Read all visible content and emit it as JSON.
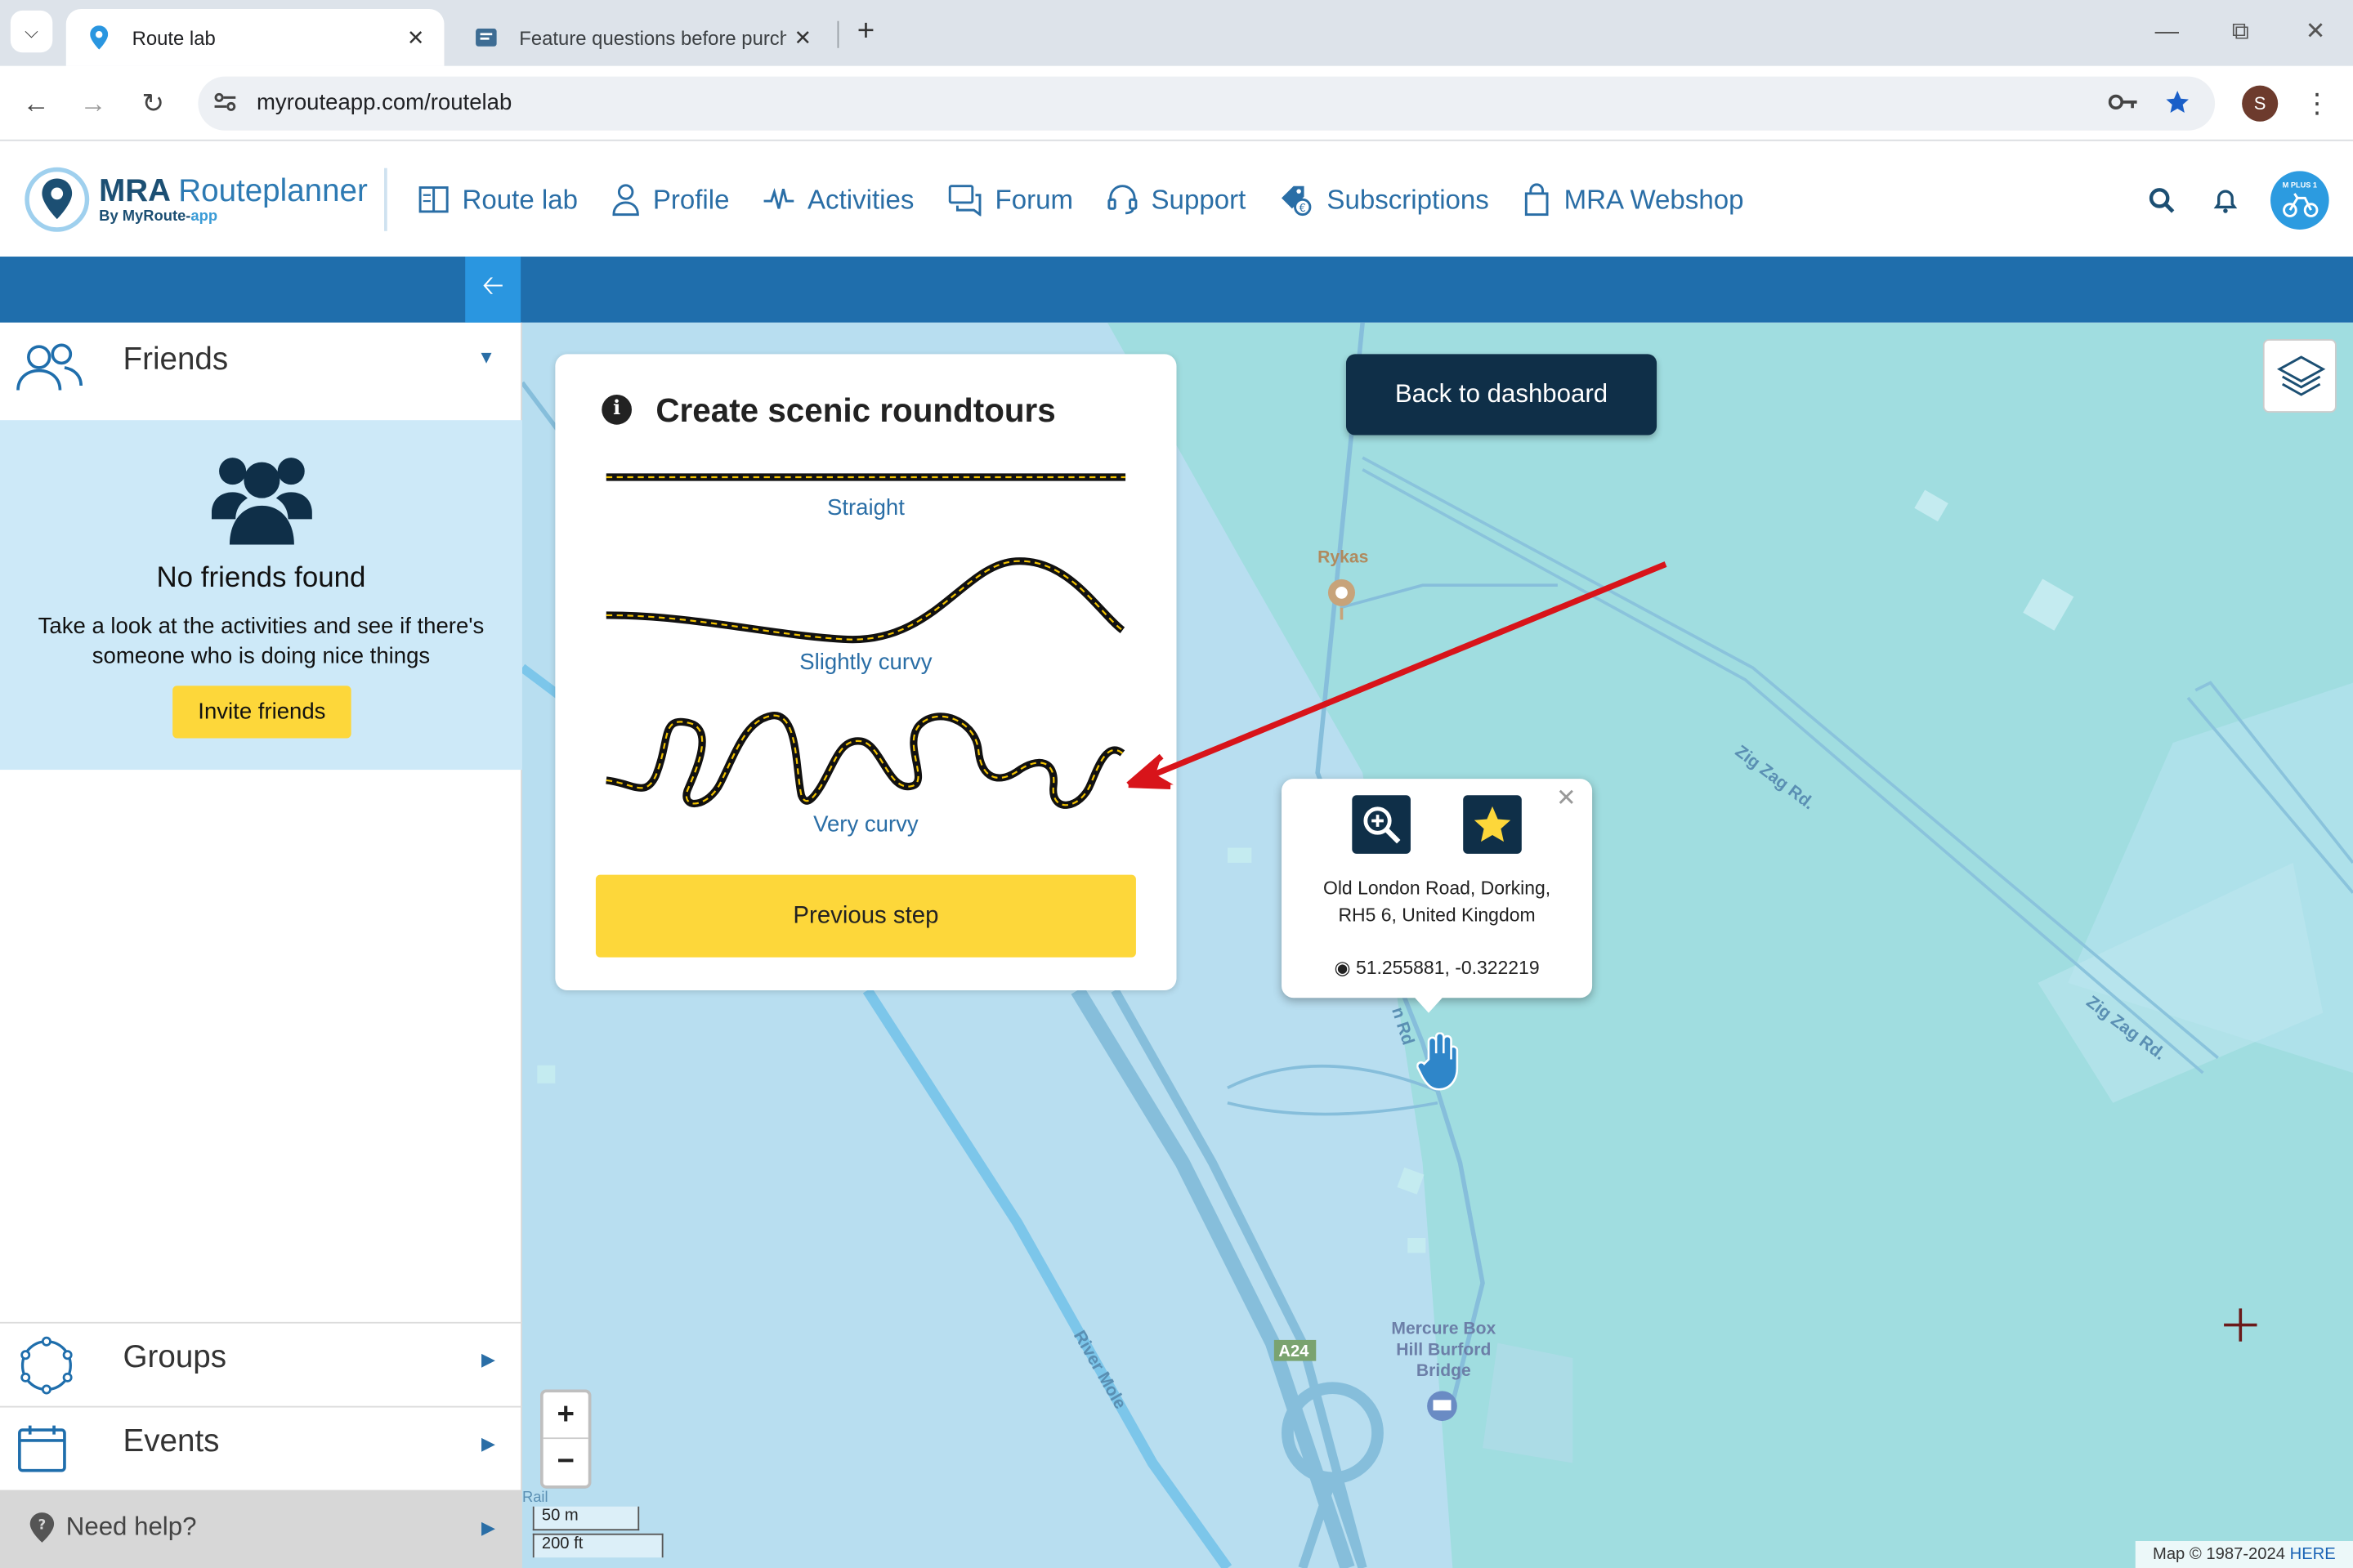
{
  "browser": {
    "tabs": [
      {
        "title": "Route lab",
        "active": true
      },
      {
        "title": "Feature questions before purch",
        "active": false
      }
    ],
    "url": "myrouteapp.com/routelab",
    "profile_initial": "S"
  },
  "header": {
    "brand": "MRA",
    "brand_sub": "Routeplanner",
    "byline_prefix": "By MyRoute-",
    "byline_suffix": "app",
    "nav": [
      {
        "label": "Route lab",
        "icon": "book-icon"
      },
      {
        "label": "Profile",
        "icon": "user-icon"
      },
      {
        "label": "Activities",
        "icon": "pulse-icon"
      },
      {
        "label": "Forum",
        "icon": "chat-icon"
      },
      {
        "label": "Support",
        "icon": "headset-icon"
      },
      {
        "label": "Subscriptions",
        "icon": "tag-icon"
      },
      {
        "label": "MRA Webshop",
        "icon": "bag-icon"
      }
    ],
    "avatar_badge": "M PLUS 1"
  },
  "sidebar": {
    "friends": {
      "title": "Friends",
      "empty_title": "No friends found",
      "empty_text": "Take a look at the activities and see if there's someone who is doing nice things",
      "invite_label": "Invite friends"
    },
    "groups_title": "Groups",
    "events_title": "Events",
    "help_title": "Need help?"
  },
  "card": {
    "title": "Create scenic roundtours",
    "options": [
      "Straight",
      "Slightly curvy",
      "Very curvy"
    ],
    "prev_label": "Previous step"
  },
  "map": {
    "back_label": "Back to dashboard",
    "popup": {
      "address_line1": "Old London Road, Dorking,",
      "address_line2": "RH5 6, United Kingdom",
      "coords": "51.255881, -0.322219"
    },
    "labels": {
      "rykas": "Rykas",
      "zigzag": "Zig Zag Rd.",
      "rivermole": "River Mole",
      "a24": "A24",
      "mercure_line1": "Mercure Box",
      "mercure_line2": "Hill Burford",
      "mercure_line3": "Bridge",
      "london_rd": "n Rd",
      "rail": "Rail"
    },
    "zoom_in": "+",
    "zoom_out": "−",
    "scale_m": "50 m",
    "scale_ft": "200 ft",
    "attribution": "Map © 1987-2024",
    "attribution_link": "HERE"
  },
  "colors": {
    "brand_blue": "#1f6eac",
    "accent_yellow": "#fdd73a",
    "dark_navy": "#0f2f48",
    "annotation_red": "#d8141a"
  }
}
